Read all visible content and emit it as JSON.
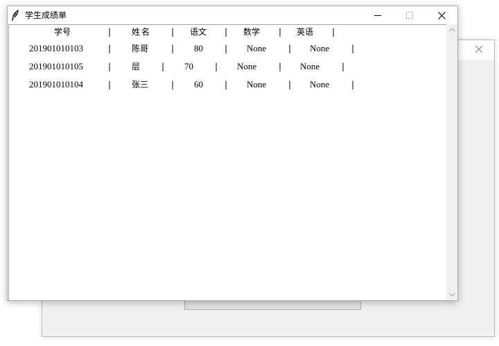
{
  "window": {
    "title": "学生成绩单"
  },
  "table": {
    "header": [
      "学号",
      "姓名",
      "语文",
      "数学",
      "英语"
    ],
    "separator": "|",
    "rows": [
      [
        "201901010103",
        "陈哥",
        "80",
        "None",
        "None"
      ],
      [
        "201901010105",
        "层",
        "70",
        "None",
        "None"
      ],
      [
        "201901010104",
        "张三",
        "60",
        "None",
        "None"
      ]
    ]
  },
  "icons": {
    "app": "feather-icon",
    "minimize": "minimize-icon",
    "maximize": "maximize-icon",
    "close": "close-icon",
    "scroll_up": "chevron-up-icon",
    "scroll_down": "chevron-down-icon",
    "bg_close": "close-icon"
  },
  "colors": {
    "window_bg": "#ffffff",
    "background_window": "#f0f0f0",
    "text": "#000000"
  }
}
